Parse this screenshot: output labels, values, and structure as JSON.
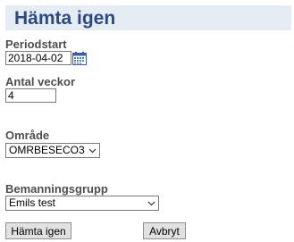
{
  "page": {
    "title": "Hämta igen"
  },
  "form": {
    "periodstart": {
      "label": "Periodstart",
      "value": "2018-04-02",
      "icon": "calendar-icon"
    },
    "antal_veckor": {
      "label": "Antal veckor",
      "value": "4"
    },
    "omrade": {
      "label": "Område",
      "selected": "OMRBESECO3"
    },
    "bemanningsgrupp": {
      "label": "Bemanningsgrupp",
      "selected": "Emils test"
    }
  },
  "buttons": {
    "fetch_label": "Hämta igen",
    "cancel_label": "Avbryt"
  },
  "colors": {
    "title": "#2d4a7e",
    "header_bg": "#e6ecf4",
    "label": "#4e4e4e",
    "button_bg": "#e1e1e1"
  }
}
